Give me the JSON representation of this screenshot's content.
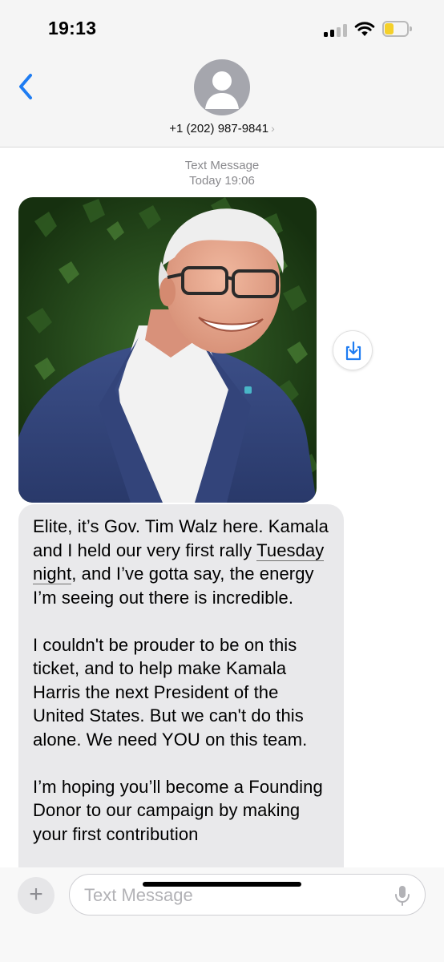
{
  "status_bar": {
    "time": "19:13",
    "battery_level": 0.4,
    "battery_color": "#f4d02a",
    "signal_bars_active": 2,
    "signal_bars_total": 4
  },
  "header": {
    "back_icon": "chevron-left-icon",
    "avatar_icon": "person-icon",
    "contact_name": "+1 (202) 987-9841",
    "contact_chevron": "›",
    "accent_color": "#1e7cf2"
  },
  "conversation": {
    "service_label": "Text Message",
    "timestamp": "Today 19:06",
    "photo_alt_icon": "photo-icon",
    "save_icon": "save-to-photos-icon",
    "message": {
      "p1_before": "Elite, it’s Gov. Tim Walz here. Kamala and I held our very first rally ",
      "p1_link": "Tuesday night",
      "p1_after": ", and I’ve gotta say, the energy I’m seeing out there is incredible.",
      "p2": "I couldn't be prouder to be on this ticket, and to help make Kamala Harris the next President of the United States. But we can't do this alone. We need YOU on this team.",
      "p3": "I’m hoping you’ll become a Founding Donor to our campaign by making your first contribution"
    }
  },
  "composer": {
    "plus_label": "+",
    "input_placeholder": "Text Message",
    "mic_icon": "microphone-icon"
  }
}
